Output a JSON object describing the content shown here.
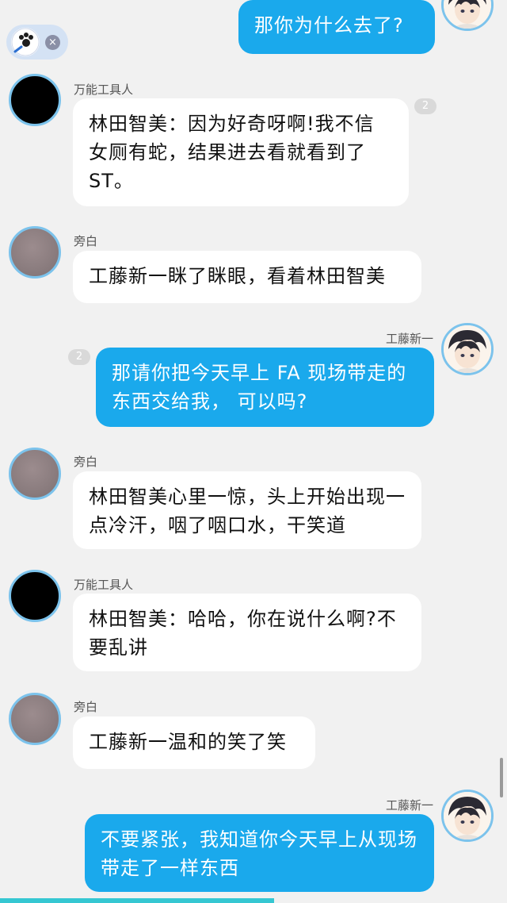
{
  "chip": {
    "close_symbol": "×"
  },
  "speakers": {
    "tool": "万能工具人",
    "narrator": "旁白",
    "shinichi": "工藤新一"
  },
  "messages": [
    {
      "text": "那你为什么去了?"
    },
    {
      "text": "林田智美：因为好奇呀啊!我不信女厕有蛇，结果进去看就看到了ST。",
      "badge": "2"
    },
    {
      "text": "工藤新一眯了眯眼，看着林田智美"
    },
    {
      "text": "那请你把今天早上 FA 现场带走的东西交给我， 可以吗?",
      "badge": "2"
    },
    {
      "text": "林田智美心里一惊，头上开始出现一点冷汗，咽了咽口水，干笑道"
    },
    {
      "text": "林田智美：哈哈，你在说什么啊?不要乱讲"
    },
    {
      "text": "工藤新一温和的笑了笑"
    },
    {
      "text": "不要紧张，我知道你今天早上从现场带走了一样东西"
    }
  ],
  "progress": {
    "fraction": 0.54
  }
}
